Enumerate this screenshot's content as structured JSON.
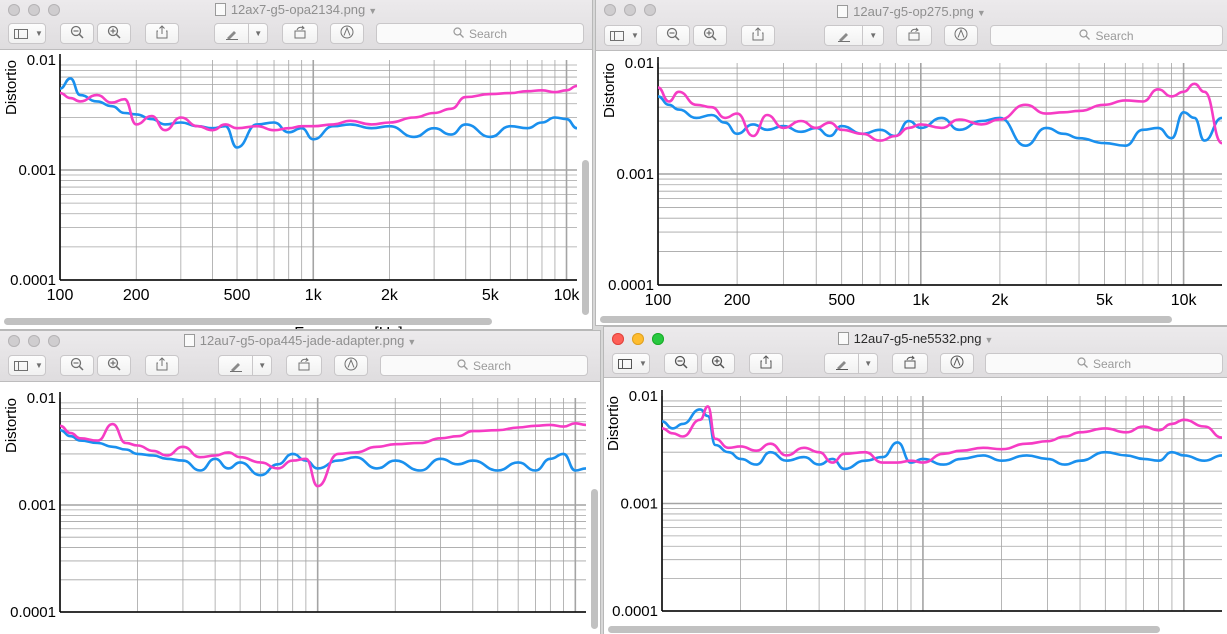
{
  "colors": {
    "series_blue": "#1a90ee",
    "series_pink": "#f63cc4",
    "grid": "#a4a4a4",
    "axis": "#000000"
  },
  "icons": {
    "sidebar": "sidebar-icon",
    "zoom_out": "zoom-out-icon",
    "zoom_in": "zoom-in-icon",
    "share": "share-icon",
    "markup": "markup-pen-icon",
    "rotate": "rotate-icon",
    "annotate": "markup-toolbar-icon",
    "search": "search-icon"
  },
  "windows": [
    {
      "title": "12ax7-g5-opa2134.png",
      "search_placeholder": "Search",
      "active": false,
      "ylabel": "Distortio",
      "xlabel": "Frequency [Hz]",
      "yticks": [
        "0.01",
        "0.001",
        "0.0001"
      ],
      "xticks": [
        "100",
        "200",
        "500",
        "1k",
        "2k",
        "5k",
        "10k"
      ]
    },
    {
      "title": "12au7-g5-op275.png",
      "search_placeholder": "Search",
      "active": false,
      "ylabel": "Distortio",
      "xlabel": "",
      "yticks": [
        "0.01",
        "0.001",
        "0.0001"
      ],
      "xticks": [
        "100",
        "200",
        "500",
        "1k",
        "2k",
        "5k",
        "10k"
      ]
    },
    {
      "title": "12au7-g5-opa445-jade-adapter.png",
      "search_placeholder": "Search",
      "active": false,
      "ylabel": "Distortio",
      "xlabel": "",
      "yticks": [
        "0.01",
        "0.001",
        "0.0001"
      ],
      "xticks": []
    },
    {
      "title": "12au7-g5-ne5532.png",
      "search_placeholder": "Search",
      "active": true,
      "ylabel": "Distortio",
      "xlabel": "",
      "yticks": [
        "0.01",
        "0.001",
        "0.0001"
      ],
      "xticks": []
    }
  ],
  "chart_data": [
    {
      "type": "line",
      "title": "",
      "xlabel": "Frequency [Hz]",
      "ylabel": "Distortio",
      "x_scale": "log",
      "y_scale": "log",
      "xlim": [
        100,
        11000
      ],
      "ylim": [
        0.0001,
        0.01
      ],
      "grid": true,
      "x": [
        100,
        110,
        120,
        140,
        160,
        180,
        200,
        230,
        260,
        300,
        350,
        400,
        450,
        500,
        600,
        700,
        800,
        900,
        1000,
        1200,
        1400,
        1700,
        2000,
        2500,
        3000,
        3500,
        4000,
        5000,
        6000,
        7000,
        8000,
        9000,
        10000,
        11000
      ],
      "series": [
        {
          "values": [
            0.0055,
            0.0068,
            0.0048,
            0.0042,
            0.0038,
            0.0033,
            0.0032,
            0.0029,
            0.0026,
            0.0027,
            0.0025,
            0.0024,
            0.0025,
            0.0016,
            0.0026,
            0.0027,
            0.0022,
            0.0024,
            0.0019,
            0.0025,
            0.0026,
            0.0024,
            0.0025,
            0.002,
            0.0024,
            0.0021,
            0.0026,
            0.002,
            0.0025,
            0.0024,
            0.0027,
            0.003,
            0.0029,
            0.0024
          ]
        },
        {
          "values": [
            0.005,
            0.0045,
            0.0042,
            0.0048,
            0.0041,
            0.0044,
            0.0026,
            0.0031,
            0.0023,
            0.003,
            0.0025,
            0.0023,
            0.0026,
            0.0024,
            0.0025,
            0.0023,
            0.0024,
            0.0025,
            0.0025,
            0.0026,
            0.0028,
            0.0026,
            0.0027,
            0.003,
            0.0033,
            0.0036,
            0.0046,
            0.0049,
            0.005,
            0.0052,
            0.0053,
            0.0051,
            0.0053,
            0.0058
          ]
        }
      ]
    },
    {
      "type": "line",
      "title": "",
      "xlabel": "",
      "ylabel": "Distortio",
      "x_scale": "log",
      "y_scale": "log",
      "xlim": [
        100,
        14000
      ],
      "ylim": [
        0.0001,
        0.01
      ],
      "grid": true,
      "x": [
        100,
        110,
        120,
        140,
        160,
        180,
        200,
        230,
        260,
        300,
        350,
        400,
        450,
        500,
        600,
        700,
        800,
        900,
        1000,
        1200,
        1400,
        1700,
        2000,
        2500,
        3000,
        3500,
        4000,
        5000,
        6000,
        7000,
        8000,
        9000,
        10000,
        11000,
        12000,
        14000
      ],
      "series": [
        {
          "values": [
            0.005,
            0.0042,
            0.0038,
            0.0032,
            0.0034,
            0.0029,
            0.0023,
            0.0028,
            0.0025,
            0.0027,
            0.0024,
            0.0026,
            0.0022,
            0.0027,
            0.0023,
            0.0025,
            0.0022,
            0.003,
            0.0026,
            0.0032,
            0.0025,
            0.003,
            0.0032,
            0.0018,
            0.0026,
            0.0023,
            0.0021,
            0.0019,
            0.0018,
            0.0025,
            0.0026,
            0.0021,
            0.0036,
            0.0032,
            0.002,
            0.0032
          ]
        },
        {
          "values": [
            0.006,
            0.0045,
            0.0055,
            0.0042,
            0.004,
            0.0032,
            0.0035,
            0.0022,
            0.0034,
            0.0026,
            0.003,
            0.0026,
            0.0029,
            0.0025,
            0.0023,
            0.002,
            0.0022,
            0.0026,
            0.0028,
            0.0026,
            0.0031,
            0.0028,
            0.0031,
            0.0042,
            0.0035,
            0.0036,
            0.0037,
            0.0042,
            0.0046,
            0.0045,
            0.0058,
            0.005,
            0.0055,
            0.0065,
            0.0055,
            0.0019
          ]
        }
      ]
    },
    {
      "type": "line",
      "title": "",
      "xlabel": "",
      "ylabel": "Distortio",
      "x_scale": "log",
      "y_scale": "log",
      "xlim": [
        100,
        11000
      ],
      "ylim": [
        0.0001,
        0.01
      ],
      "grid": true,
      "x": [
        100,
        110,
        120,
        140,
        160,
        180,
        200,
        230,
        260,
        300,
        350,
        400,
        450,
        500,
        600,
        700,
        800,
        900,
        1000,
        1200,
        1400,
        1700,
        2000,
        2500,
        3000,
        3500,
        4000,
        5000,
        6000,
        7000,
        8000,
        9000,
        10000,
        11000
      ],
      "series": [
        {
          "values": [
            0.005,
            0.0044,
            0.004,
            0.0038,
            0.0035,
            0.0033,
            0.003,
            0.0029,
            0.0027,
            0.0026,
            0.0021,
            0.0027,
            0.0022,
            0.0025,
            0.0019,
            0.0024,
            0.003,
            0.0026,
            0.0022,
            0.0026,
            0.0028,
            0.0022,
            0.0026,
            0.0021,
            0.0027,
            0.0024,
            0.0026,
            0.0021,
            0.0025,
            0.0021,
            0.0027,
            0.003,
            0.0021,
            0.0022
          ]
        },
        {
          "values": [
            0.0055,
            0.0047,
            0.0042,
            0.004,
            0.0057,
            0.0038,
            0.0036,
            0.0032,
            0.0029,
            0.0035,
            0.0028,
            0.0029,
            0.0031,
            0.0028,
            0.0025,
            0.0022,
            0.0026,
            0.0027,
            0.0015,
            0.003,
            0.0031,
            0.0035,
            0.0037,
            0.0038,
            0.0042,
            0.0044,
            0.0049,
            0.005,
            0.0053,
            0.0055,
            0.0056,
            0.0054,
            0.0058,
            0.0056
          ]
        }
      ]
    },
    {
      "type": "line",
      "title": "",
      "xlabel": "",
      "ylabel": "Distortio",
      "x_scale": "log",
      "y_scale": "log",
      "xlim": [
        100,
        14000
      ],
      "ylim": [
        0.0001,
        0.01
      ],
      "grid": true,
      "x": [
        100,
        110,
        120,
        140,
        150,
        160,
        180,
        200,
        230,
        260,
        300,
        350,
        400,
        450,
        500,
        600,
        700,
        800,
        900,
        1000,
        1200,
        1400,
        1700,
        2000,
        2500,
        3000,
        3500,
        4000,
        5000,
        6000,
        7000,
        8000,
        9000,
        10000,
        12000,
        14000
      ],
      "series": [
        {
          "values": [
            0.0058,
            0.005,
            0.0055,
            0.0075,
            0.0065,
            0.0035,
            0.003,
            0.0026,
            0.0023,
            0.003,
            0.0025,
            0.0027,
            0.0023,
            0.0026,
            0.0021,
            0.0025,
            0.0027,
            0.0037,
            0.0024,
            0.0026,
            0.0023,
            0.0026,
            0.0028,
            0.0025,
            0.0028,
            0.0026,
            0.0023,
            0.0025,
            0.003,
            0.0028,
            0.0026,
            0.0025,
            0.003,
            0.0028,
            0.0025,
            0.0028
          ]
        },
        {
          "values": [
            0.005,
            0.0045,
            0.0042,
            0.006,
            0.008,
            0.004,
            0.0033,
            0.0034,
            0.0031,
            0.0036,
            0.0028,
            0.0033,
            0.003,
            0.0024,
            0.0029,
            0.003,
            0.0024,
            0.0024,
            0.0025,
            0.0024,
            0.0029,
            0.0031,
            0.0033,
            0.0032,
            0.0036,
            0.0038,
            0.0042,
            0.0046,
            0.005,
            0.0046,
            0.0052,
            0.0048,
            0.0055,
            0.006,
            0.0052,
            0.0041
          ]
        }
      ]
    }
  ]
}
